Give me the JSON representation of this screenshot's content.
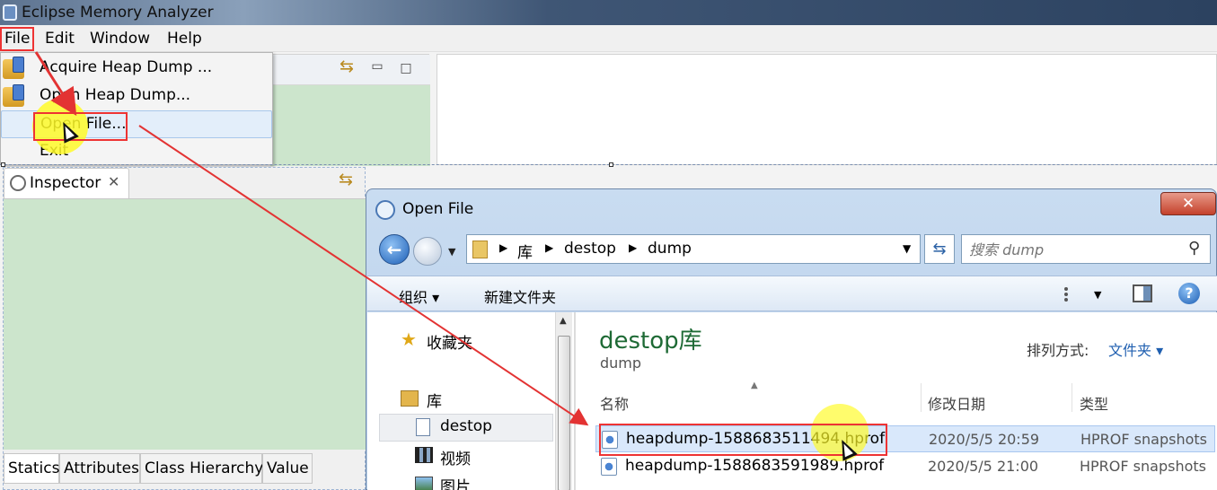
{
  "window": {
    "title": "Eclipse Memory Analyzer"
  },
  "menubar": {
    "items": [
      "File",
      "Edit",
      "Window",
      "Help"
    ]
  },
  "file_menu": {
    "items": [
      "Acquire Heap Dump ...",
      "Open Heap Dump...",
      "Open File...",
      "Exit"
    ]
  },
  "inspector": {
    "tab_label": "Inspector",
    "bottom_tabs": [
      "Statics",
      "Attributes",
      "Class Hierarchy",
      "Value"
    ]
  },
  "dialog": {
    "title": "Open File",
    "breadcrumb": [
      "库",
      "destop",
      "dump"
    ],
    "search_placeholder": "搜索 dump",
    "toolbar": {
      "organize": "组织 ▾",
      "new_folder": "新建文件夹"
    },
    "nav": [
      {
        "label": "收藏夹",
        "icon": "favorites-star-icon"
      },
      {
        "label": "库",
        "icon": "library-icon"
      },
      {
        "label": "destop",
        "icon": "document-library-icon"
      },
      {
        "label": "视频",
        "icon": "video-icon"
      },
      {
        "label": "图片",
        "icon": "picture-icon"
      }
    ],
    "library_title": "destop库",
    "library_subtitle": "dump",
    "arrange_label": "排列方式:",
    "arrange_value": "文件夹 ▾",
    "columns": [
      "名称",
      "修改日期",
      "类型"
    ],
    "files": [
      {
        "name": "heapdump-1588683511494.hprof",
        "date": "2020/5/5 20:59",
        "type": "HPROF snapshots"
      },
      {
        "name": "heapdump-1588683591989.hprof",
        "date": "2020/5/5 21:00",
        "type": "HPROF snapshots"
      }
    ]
  },
  "colors": {
    "annotation_red": "#e33333",
    "highlight_yellow": "#fffa28",
    "library_title_green": "#1e6a35"
  }
}
